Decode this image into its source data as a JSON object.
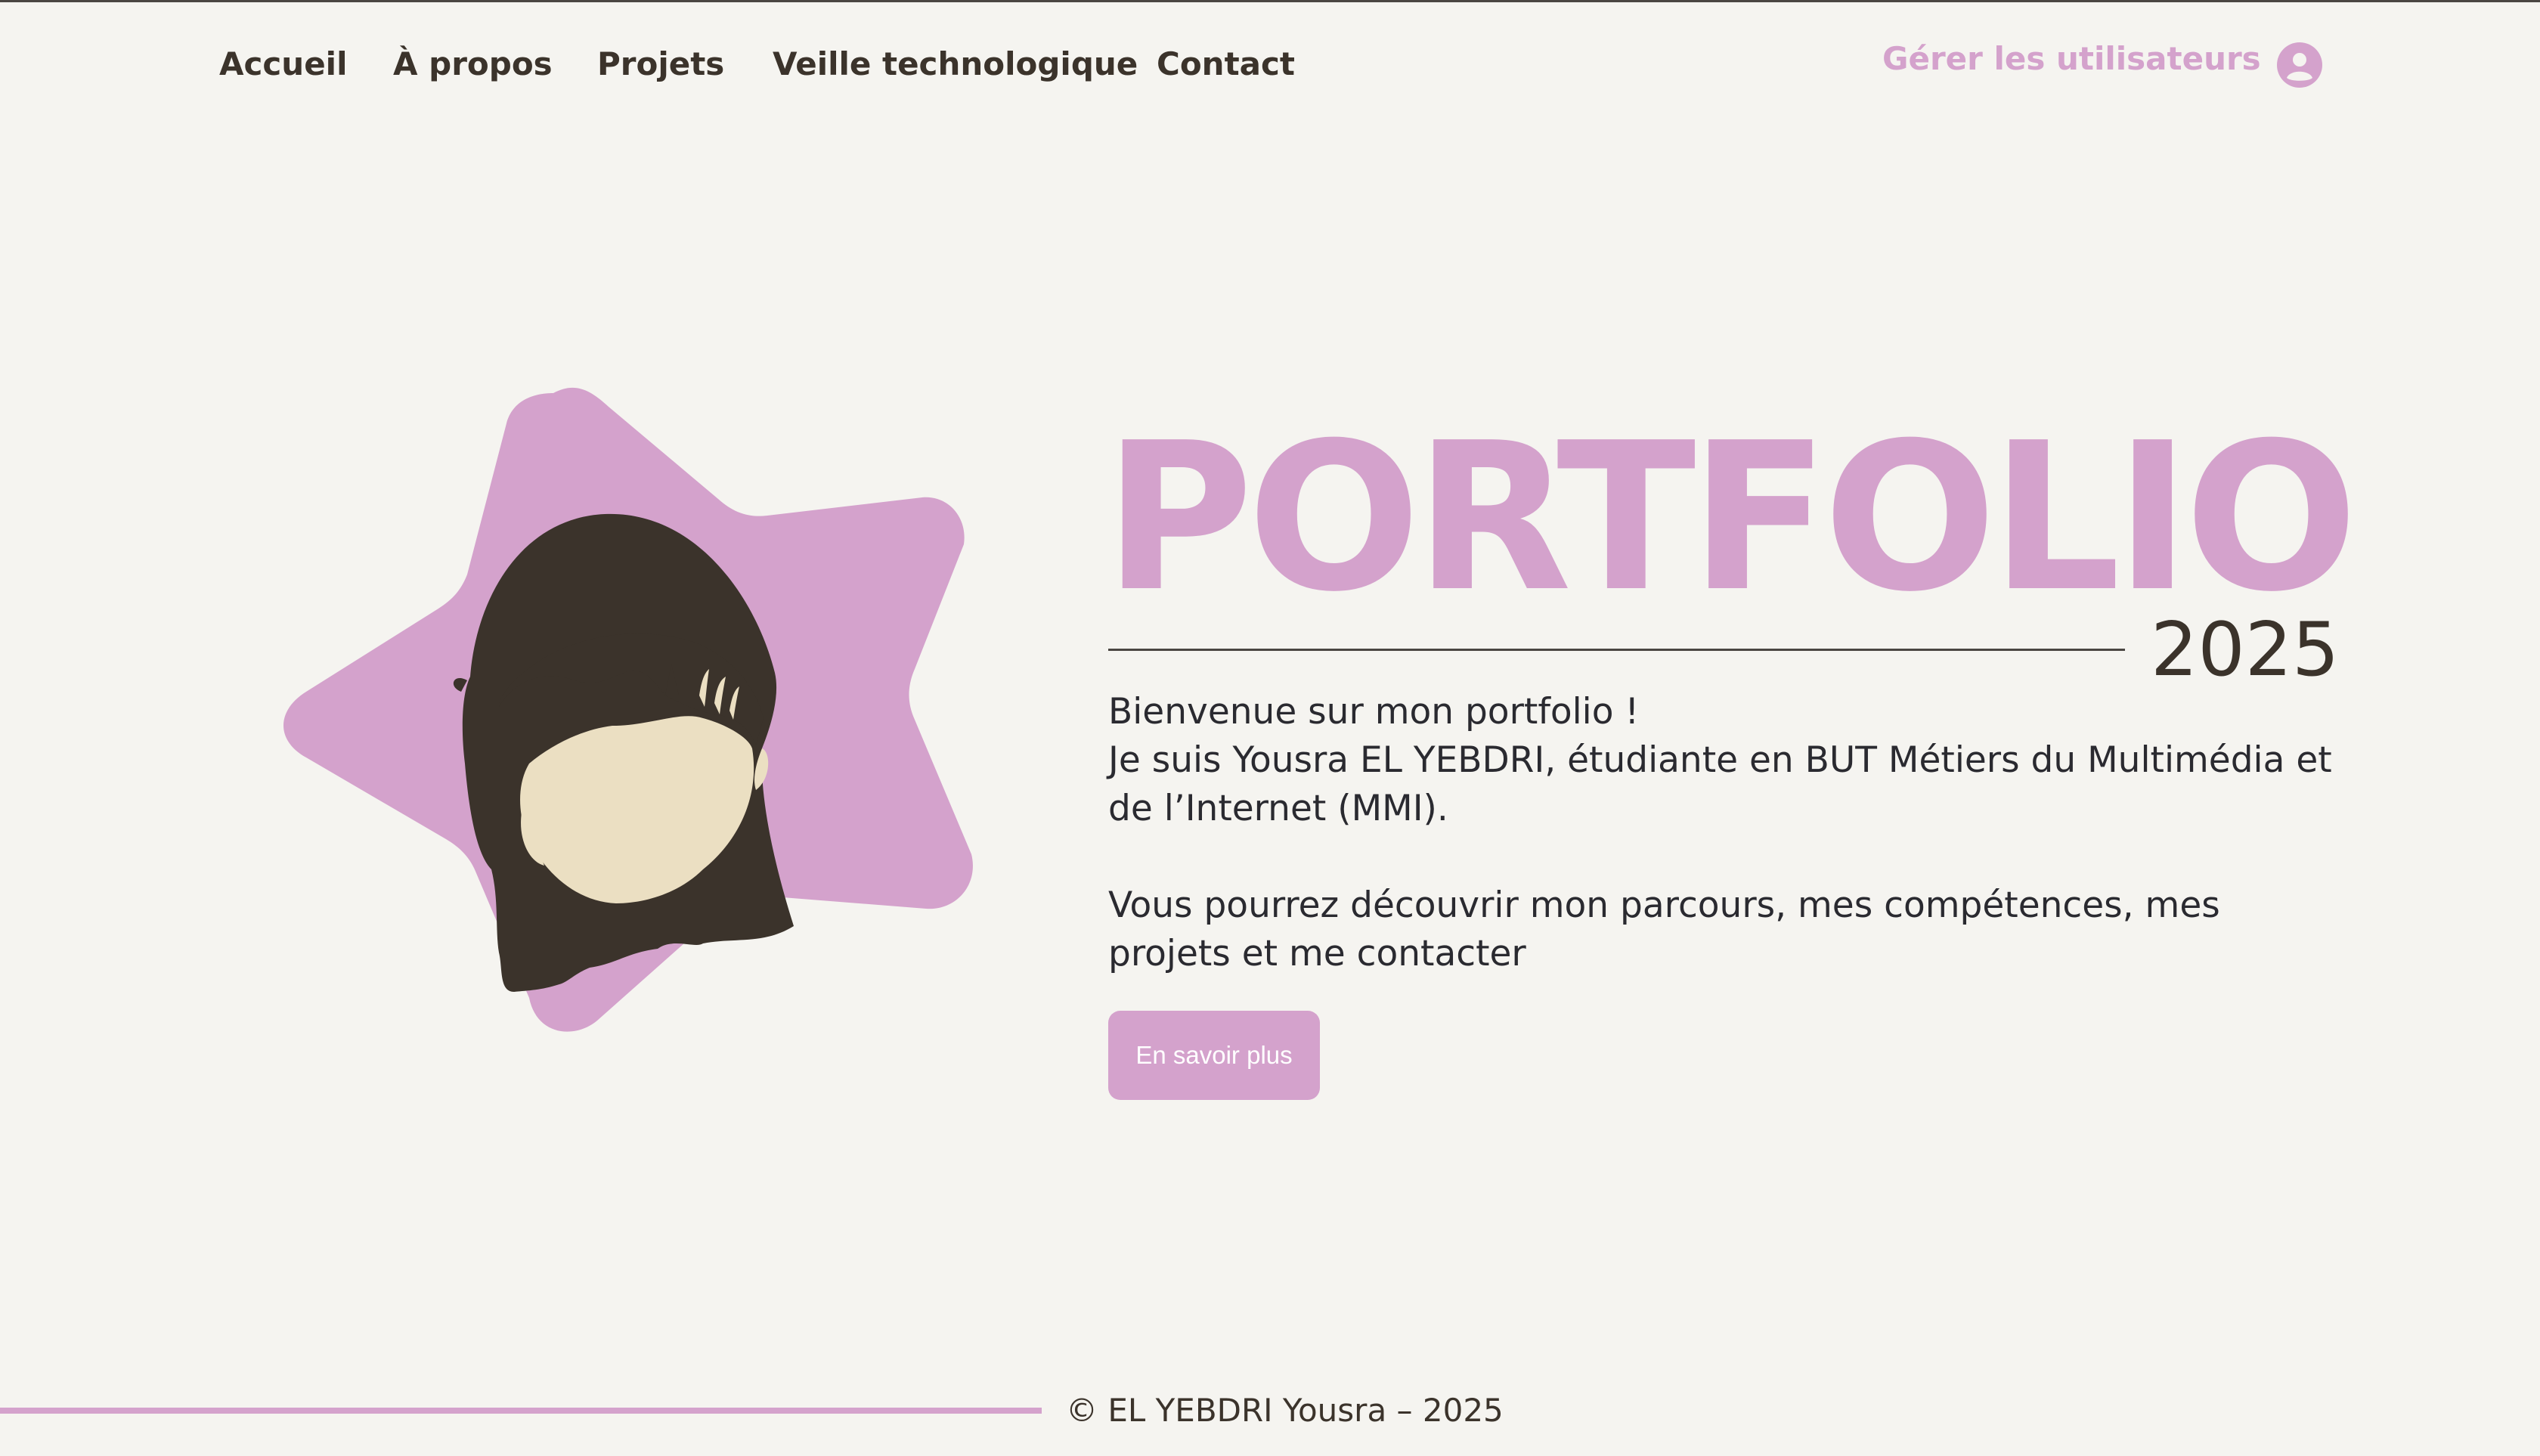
{
  "nav": {
    "items": [
      {
        "label": "Accueil"
      },
      {
        "label": "À propos"
      },
      {
        "label": "Projets"
      },
      {
        "label": "Veille technologique"
      },
      {
        "label": "Contact"
      }
    ],
    "manage_users": "Gérer les utilisateurs",
    "user_icon": "user-circle-icon"
  },
  "hero": {
    "title": "PORTFOLIO",
    "year": "2025",
    "intro_lines": [
      "Bienvenue sur mon portfolio !",
      "Je suis Yousra EL YEBDRI, étudiante en BUT Métiers du Multimédia et de l’Internet (MMI)."
    ],
    "discover": "Vous pourrez découvrir mon parcours, mes compétences, mes projets et me contacter",
    "cta_label": "En savoir plus",
    "avatar_image": "star-avatar-illustration"
  },
  "footer": {
    "copyright": "© EL YEBDRI Yousra – 2025"
  },
  "colors": {
    "accent": "#d4a2cc",
    "text": "#3b332b",
    "background": "#f5f4f0",
    "hair": "#3b332b",
    "skin": "#ebdfc2"
  }
}
